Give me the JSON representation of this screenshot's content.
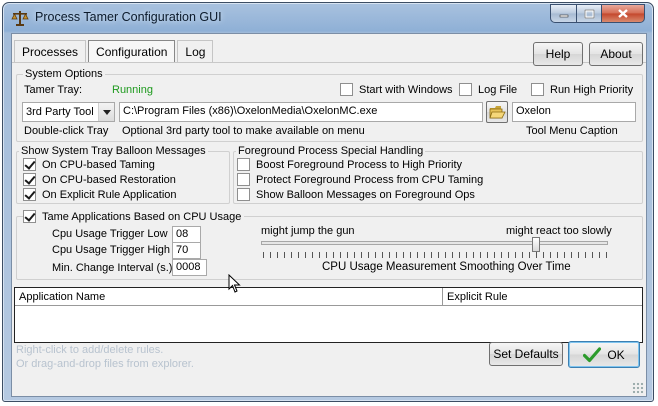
{
  "window": {
    "title": "Process Tamer Configuration GUI"
  },
  "tabs": [
    {
      "label": "Processes",
      "active": false
    },
    {
      "label": "Configuration",
      "active": true
    },
    {
      "label": "Log",
      "active": false
    }
  ],
  "header_buttons": {
    "help": "Help",
    "about": "About"
  },
  "system_options": {
    "legend": "System Options",
    "tamer_tray_label": "Tamer Tray:",
    "tamer_tray_status": "Running",
    "status_color": "#1e9a1e",
    "start_with_windows": {
      "label": "Start with Windows",
      "checked": false
    },
    "log_file": {
      "label": "Log File",
      "checked": false
    },
    "run_high_priority": {
      "label": "Run High Priority",
      "checked": false
    },
    "tool_select": "3rd Party Tool",
    "tool_path": "C:\\Program Files (x86)\\OxelonMedia\\OxelonMC.exe",
    "tool_caption": "Oxelon",
    "double_click_label": "Double-click Tray",
    "optional_label": "Optional 3rd party tool to make available on menu",
    "tool_caption_label": "Tool Menu Caption"
  },
  "balloon": {
    "legend": "Show System Tray Balloon Messages",
    "items": [
      {
        "label": "On CPU-based Taming",
        "checked": true
      },
      {
        "label": "On CPU-based Restoration",
        "checked": true
      },
      {
        "label": "On Explicit Rule Application",
        "checked": true
      }
    ]
  },
  "foreground": {
    "legend": "Foreground Process Special Handling",
    "items": [
      {
        "label": "Boost Foreground Process to High Priority",
        "checked": false
      },
      {
        "label": "Protect Foreground Process from CPU Taming",
        "checked": false
      },
      {
        "label": "Show Balloon Messages on Foreground Ops",
        "checked": false
      }
    ]
  },
  "cpu": {
    "legend": "Tame Applications Based on CPU Usage",
    "legend_checked": true,
    "trigger_low_label": "Cpu Usage Trigger Low",
    "trigger_low": "08",
    "trigger_high_label": "Cpu Usage Trigger High",
    "trigger_high": "70",
    "min_change_label": "Min. Change Interval (s.)",
    "min_change": "0008",
    "slider_left_label": "might jump the gun",
    "slider_right_label": "might react too slowly",
    "slider_caption": "CPU Usage Measurement Smoothing Over Time",
    "slider_position": 0.8
  },
  "rules_table": {
    "columns": [
      "Application Name",
      "Explicit Rule"
    ]
  },
  "hints": {
    "line1": "Right-click to add/delete rules.",
    "line2": "Or drag-and-drop files from explorer."
  },
  "footer_buttons": {
    "set_defaults": "Set Defaults",
    "ok": "OK"
  }
}
